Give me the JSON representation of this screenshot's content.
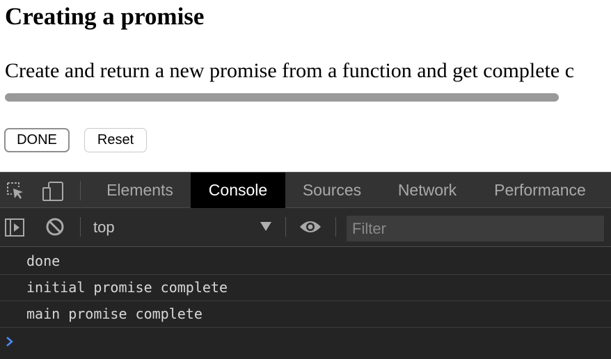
{
  "page": {
    "title": "Creating a promise",
    "description": "Create and return a new promise from a function and get complete c",
    "progress": 1.0,
    "buttons": {
      "done": "DONE",
      "reset": "Reset"
    }
  },
  "devtools": {
    "icons": {
      "inspect": "inspect-element-icon",
      "device": "device-toolbar-icon",
      "sidebar": "console-sidebar-icon",
      "clear": "clear-console-icon",
      "eye": "live-expression-eye-icon",
      "prompt": "chevron-right-icon"
    },
    "tabs": [
      {
        "label": "Elements",
        "active": false
      },
      {
        "label": "Console",
        "active": true
      },
      {
        "label": "Sources",
        "active": false
      },
      {
        "label": "Network",
        "active": false
      },
      {
        "label": "Performance",
        "active": false
      }
    ],
    "context": "top",
    "filter_placeholder": "Filter",
    "logs": [
      "done",
      "initial promise complete",
      "main promise complete"
    ],
    "colors": {
      "prompt": "#4a8af4"
    }
  }
}
